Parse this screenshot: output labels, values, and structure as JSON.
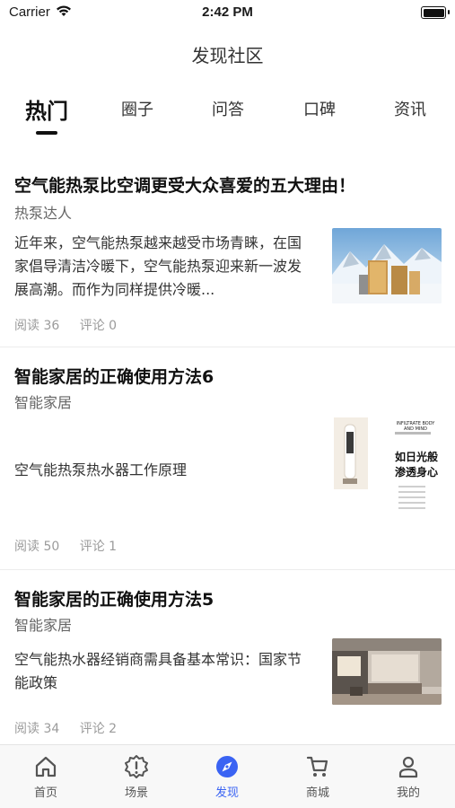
{
  "status_bar": {
    "carrier": "Carrier",
    "time": "2:42 PM"
  },
  "nav": {
    "title": "发现社区"
  },
  "tabs": [
    {
      "label": "热门",
      "active": true
    },
    {
      "label": "圈子"
    },
    {
      "label": "问答"
    },
    {
      "label": "口碑"
    },
    {
      "label": "资讯"
    }
  ],
  "posts": [
    {
      "title": "空气能热泵比空调更受大众喜爱的五大理由！",
      "author": "热泵达人",
      "excerpt": "近年来，空气能热泵越来越受市场青睐，在国家倡导清洁冷暖下，空气能热泵迎来新一波发展高潮。而作为同样提供冷暖...",
      "reads": "阅读 36",
      "comments": "评论 0",
      "thumb": "snow-mountain-heat-pump-image"
    },
    {
      "title": "智能家居的正确使用方法6",
      "author": "智能家居",
      "excerpt": "空气能热泵热水器工作原理",
      "reads": "阅读 50",
      "comments": "评论 1",
      "thumb": "product-brochure-image",
      "thumb_text": {
        "en": "INFILTRATE BODY AND MIND",
        "cn": "如日光般渗透身心"
      }
    },
    {
      "title": "智能家居的正确使用方法5",
      "author": "智能家居",
      "excerpt": "空气能热水器经销商需具备基本常识：国家节能政策",
      "reads": "阅读 34",
      "comments": "评论 2",
      "thumb": "living-room-interior-image"
    }
  ],
  "tabbar": [
    {
      "label": "首页",
      "icon": "home-icon"
    },
    {
      "label": "场景",
      "icon": "alert-badge-icon"
    },
    {
      "label": "发现",
      "icon": "compass-icon",
      "active": true
    },
    {
      "label": "商城",
      "icon": "cart-icon"
    },
    {
      "label": "我的",
      "icon": "person-icon"
    }
  ],
  "colors": {
    "accent": "#3a63f3",
    "text": "#111111",
    "muted": "#9b9b9b"
  }
}
